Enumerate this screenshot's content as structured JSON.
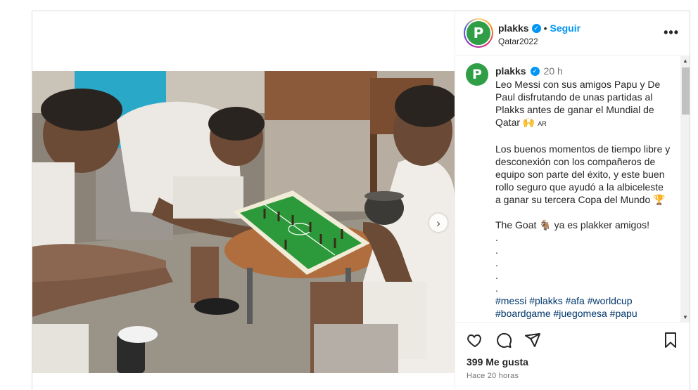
{
  "post": {
    "username": "plakks",
    "verified_mark": "✓",
    "separator": "•",
    "follow_label": "Seguir",
    "location": "Qatar2022",
    "more_label": "•••",
    "avatar_letter": "P",
    "time": "20 h",
    "caption_lines": {
      "p1": "Leo Messi con sus amigos Papu y De Paul disfrutando de unas partidas al Plakks antes de ganar el Mundial de Qatar 🙌",
      "p1_flag": "AR",
      "p2": "Los buenos momentos de tiempo libre y desconexión con los compañeros de equipo son parte del éxito, y este buen rollo seguro que ayudó a la albiceleste a ganar su tercera Copa del Mundo 🏆",
      "p3": "The Goat 🐐 ya es plakker amigos!",
      "dots": [
        ".",
        ".",
        ".",
        ".",
        "."
      ],
      "hashtags": "#messi #plakks #afa #worldcup #boardgame #juegomesa #papu #depaul #futbol #football"
    },
    "likes": "399 Me gusta",
    "posted_ago": "Hace 20 horas",
    "next_arrow": "›"
  },
  "icons": {
    "like": "heart-outline-icon",
    "comment": "speech-bubble-icon",
    "share": "paper-plane-icon",
    "save": "bookmark-icon",
    "next": "chevron-right-icon"
  },
  "colors": {
    "follow_blue": "#0095f6",
    "verified_blue": "#0095f6",
    "hashtag": "#00376b",
    "brand_green": "#2f9e46"
  }
}
